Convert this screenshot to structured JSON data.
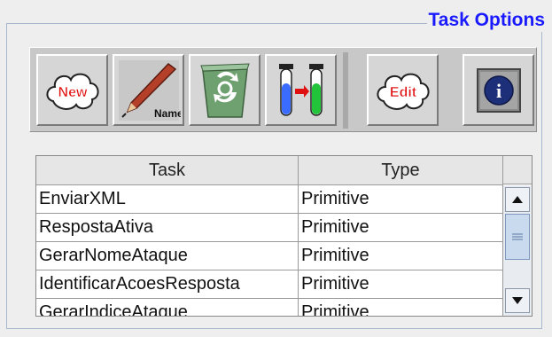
{
  "panel": {
    "title": "Task Options"
  },
  "toolbar": {
    "new_label": "New",
    "rename_label": "Name",
    "edit_label": "Edit",
    "info_label": "i"
  },
  "table": {
    "columns": [
      "Task",
      "Type"
    ],
    "rows": [
      [
        "EnviarXML",
        "Primitive"
      ],
      [
        "RespostaAtiva",
        "Primitive"
      ],
      [
        "GerarNomeAtaque",
        "Primitive"
      ],
      [
        "IdentificarAcoesResposta",
        "Primitive"
      ],
      [
        "GerarIndiceAtaque",
        "Primitive"
      ]
    ]
  },
  "colors": {
    "title": "#1a1aff",
    "accent_red": "#e01010",
    "toolbar_bg": "#c8c8c8"
  },
  "icons": [
    "new-cloud-icon",
    "rename-pencil-icon",
    "recycle-bin-icon",
    "test-tubes-icon",
    "edit-cloud-icon",
    "info-icon"
  ]
}
